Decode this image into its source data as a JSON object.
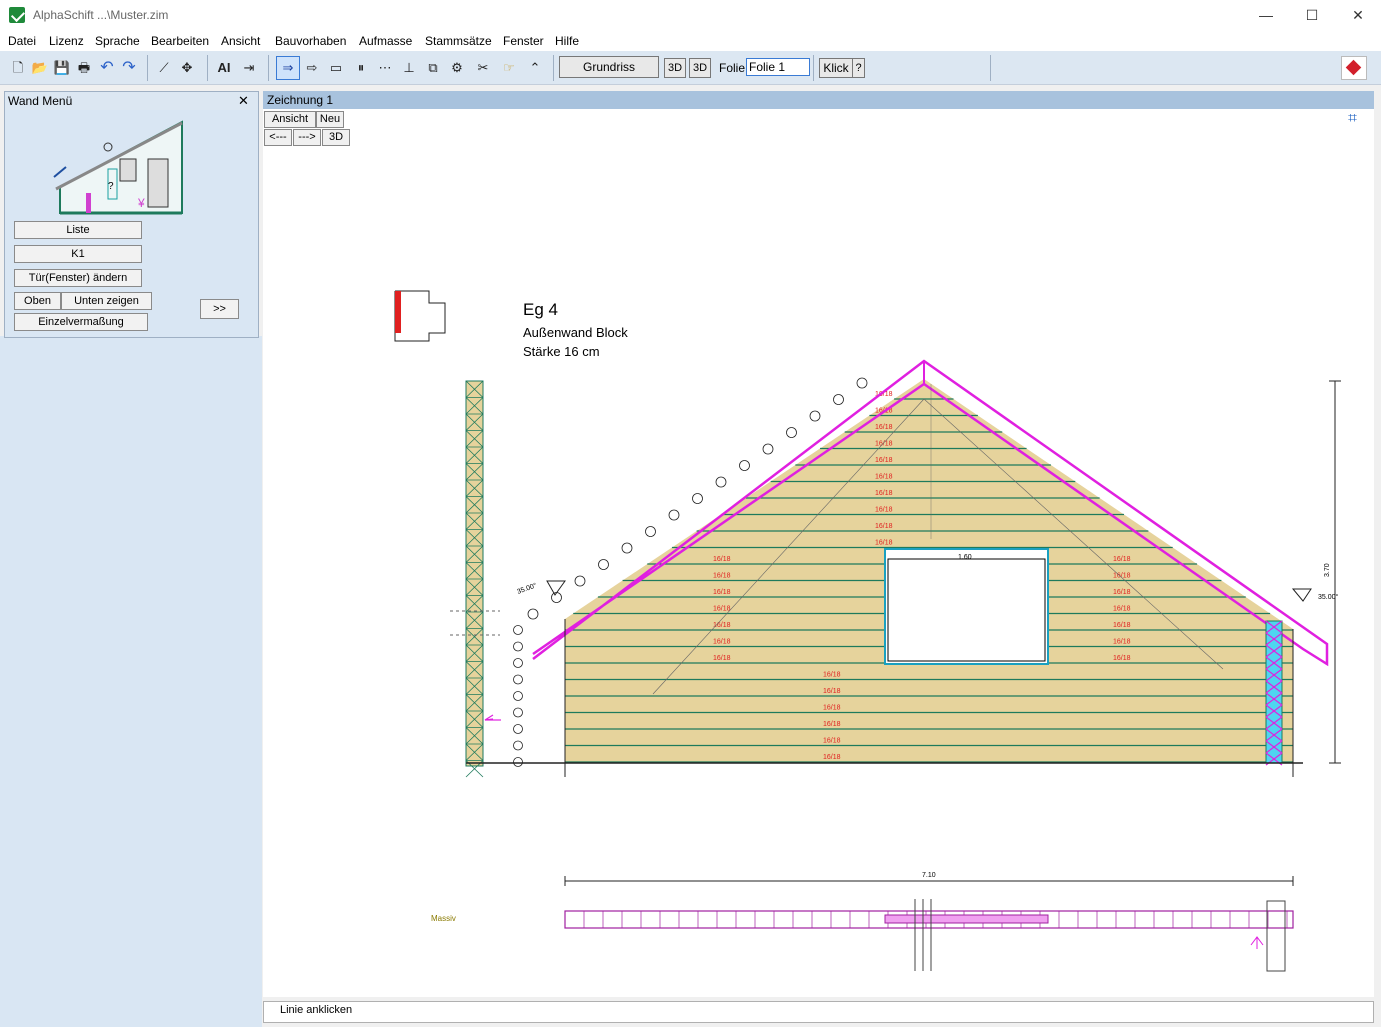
{
  "window": {
    "title": "AlphaSchift ...\\Muster.zim",
    "minimize": "—",
    "maximize": "☐",
    "close": "✕"
  },
  "menu": [
    "Datei",
    "Lizenz",
    "Sprache",
    "Bearbeiten",
    "Ansicht",
    "Bauvorhaben",
    "Aufmasse",
    "Stammsätze",
    "Fenster",
    "Hilfe"
  ],
  "toolbar": {
    "grundriss": "Grundriss",
    "view3d_a": "3D",
    "view3d_b": "3D",
    "folie_label": "Folie:",
    "folie_value": "Folie 1",
    "klick": "Klick",
    "help": "?"
  },
  "left_panel": {
    "title": "Wand Menü",
    "close": "✕",
    "buttons": {
      "liste": "Liste",
      "k1": "K1",
      "tuer": "Tür(Fenster) ändern",
      "oben": "Oben",
      "unten": "Unten zeigen",
      "einzel": "Einzelvermaßung",
      "more": ">>"
    }
  },
  "drawing": {
    "tab": "Zeichnung 1",
    "buttons": {
      "ansicht": "Ansicht",
      "neu": "Neu",
      "back": "<---",
      "fwd": "--->",
      "three_d": "3D"
    },
    "wall_title": "Eg  4",
    "wall_type": "Außenwand  Block",
    "wall_thickness": "Stärke  16 cm",
    "board_label": "16/18",
    "length_dim": "7.10",
    "window_width": "1.60",
    "height_dim": "3.70",
    "angle_left": "35.00°",
    "angle_right": "35.00°",
    "massiv": "Massiv"
  },
  "status": {
    "text": "Linie anklicken"
  }
}
